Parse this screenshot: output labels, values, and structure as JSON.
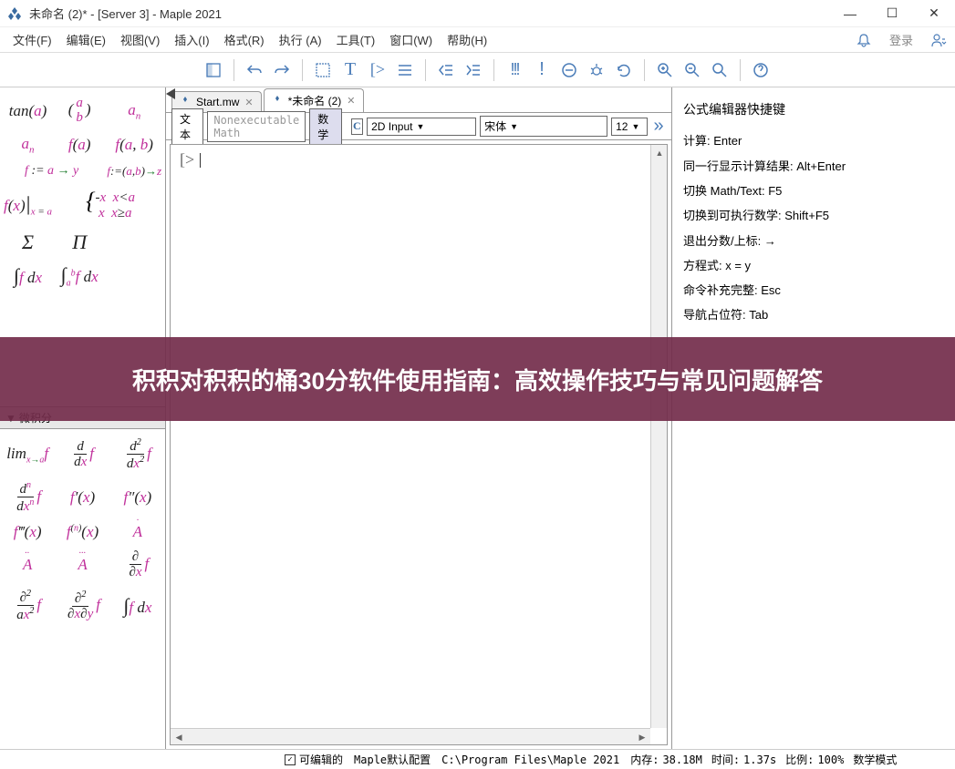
{
  "window": {
    "title": "未命名 (2)* - [Server 3] - Maple 2021"
  },
  "menu": {
    "items": [
      "文件(F)",
      "编辑(E)",
      "视图(V)",
      "插入(I)",
      "格式(R)",
      "执行 (A)",
      "工具(T)",
      "窗口(W)",
      "帮助(H)"
    ],
    "login": "登录"
  },
  "tabs": [
    {
      "label": "Start.mw",
      "active": false
    },
    {
      "label": "*未命名 (2)",
      "active": true
    }
  ],
  "format": {
    "text_btn": "文本",
    "nonexec": "Nonexecutable Math",
    "math_btn": "数学",
    "input_mode": "2D Input",
    "font": "宋体",
    "size": "12"
  },
  "palette_header": "▼ 微积分",
  "hints": {
    "title": "公式编辑器快捷键",
    "items": [
      "计算:  Enter",
      "同一行显示计算结果:  Alt+Enter",
      "切换 Math/Text:  F5",
      "切换到可执行数学:  Shift+F5",
      "退出分数/上标:  →",
      "",
      "",
      "方程式:  x = y",
      "命令补充完整:  Esc",
      "导航占位符:  Tab"
    ]
  },
  "overlay": {
    "text": "积积对积积的桶30分软件使用指南：高效操作技巧与常见问题解答"
  },
  "status": {
    "editable": "可编辑的",
    "config": "Maple默认配置",
    "path": "C:\\Program Files\\Maple 2021",
    "memory_label": "内存:",
    "memory": "38.18M",
    "time_label": "时间:",
    "time": "1.37s",
    "scale_label": "比例:",
    "scale": "100%",
    "mode": "数学模式"
  }
}
